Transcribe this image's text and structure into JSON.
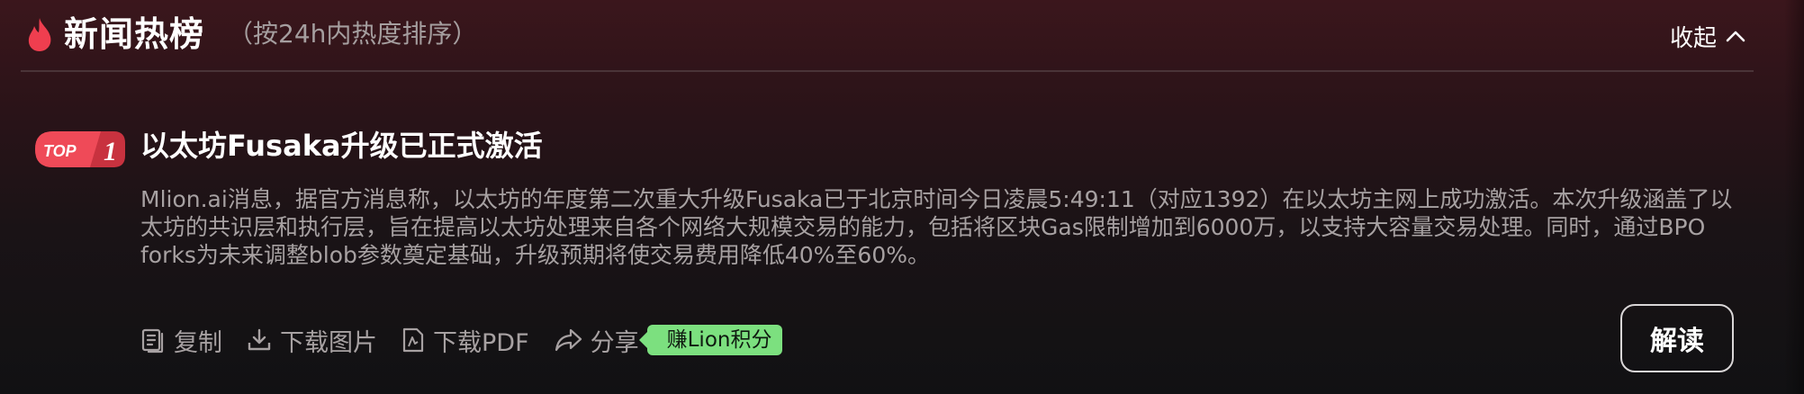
{
  "header": {
    "title": "新闻热榜",
    "subtitle": "（按24h内热度排序）",
    "collapse_label": "收起",
    "icons": {
      "flame": "flame-icon",
      "collapse": "chevron-up-icon"
    }
  },
  "article": {
    "rank_badge": {
      "label": "TOP",
      "rank": "1"
    },
    "headline": "以太坊Fusaka升级已正式激活",
    "body": "Mlion.ai消息，据官方消息称，以太坊的年度第二次重大升级Fusaka已于北京时间今日凌晨5:49:11（对应1392）在以太坊主网上成功激活。本次升级涵盖了以太坊的共识层和执行层，旨在提高以太坊处理来自各个网络大规模交易的能力，包括将区块Gas限制增加到6000万，以支持大容量交易处理。同时，通过BPO forks为未来调整blob参数奠定基础，升级预期将使交易费用降低40%至60%。"
  },
  "actions": {
    "copy": "复制",
    "download_image": "下载图片",
    "download_pdf": "下载PDF",
    "share": "分享",
    "reward_badge": "赚Lion积分",
    "interpret": "解读"
  },
  "colors": {
    "accent_red": "#e8414f",
    "reward_green": "#7ce07f",
    "muted_text": "#a7a1a2"
  }
}
